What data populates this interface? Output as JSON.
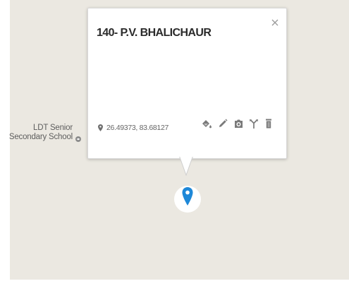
{
  "poi": {
    "label": "LDT Senior\nSecondary School",
    "icon": "school-pin-icon"
  },
  "popup": {
    "title": "140- P.V. BHALICHAUR",
    "close_label": "X",
    "coordinates": "26.49373, 83.68127",
    "coordinates_icon": "location-pin-icon",
    "tools": [
      {
        "name": "style-paint-icon"
      },
      {
        "name": "edit-pencil-icon"
      },
      {
        "name": "camera-icon"
      },
      {
        "name": "directions-icon"
      },
      {
        "name": "delete-trash-icon"
      }
    ]
  },
  "marker": {
    "icon": "map-marker-icon",
    "color": "#1e88d8"
  },
  "colors": {
    "map_background": "#ebe8e1",
    "icon_gray": "#7a7a7a"
  }
}
